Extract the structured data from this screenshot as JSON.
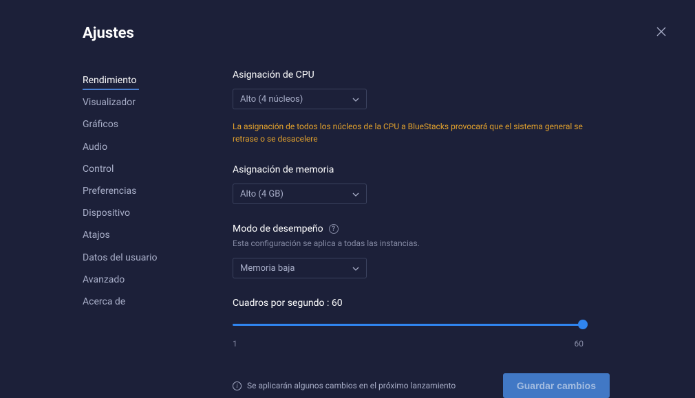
{
  "header": {
    "title": "Ajustes"
  },
  "sidebar": {
    "items": [
      {
        "label": "Rendimiento",
        "active": true
      },
      {
        "label": "Visualizador",
        "active": false
      },
      {
        "label": "Gráficos",
        "active": false
      },
      {
        "label": "Audio",
        "active": false
      },
      {
        "label": "Control",
        "active": false
      },
      {
        "label": "Preferencias",
        "active": false
      },
      {
        "label": "Dispositivo",
        "active": false
      },
      {
        "label": "Atajos",
        "active": false
      },
      {
        "label": "Datos del usuario",
        "active": false
      },
      {
        "label": "Avanzado",
        "active": false
      },
      {
        "label": "Acerca de",
        "active": false
      }
    ]
  },
  "cpu": {
    "label": "Asignación de CPU",
    "value": "Alto (4 núcleos)",
    "warning": "La asignación de todos los núcleos de la CPU a BlueStacks provocará que el sistema general se retrase o se desacelere"
  },
  "memory": {
    "label": "Asignación de memoria",
    "value": "Alto (4 GB)"
  },
  "performance": {
    "label": "Modo de desempeño",
    "sublabel": "Esta configuración se aplica a todas las instancias.",
    "value": "Memoria baja"
  },
  "fps": {
    "label_prefix": "Cuadros por segundo : ",
    "value": "60",
    "min": "1",
    "max": "60"
  },
  "footer": {
    "info": "Se aplicarán algunos cambios en el próximo lanzamiento",
    "save": "Guardar cambios"
  }
}
